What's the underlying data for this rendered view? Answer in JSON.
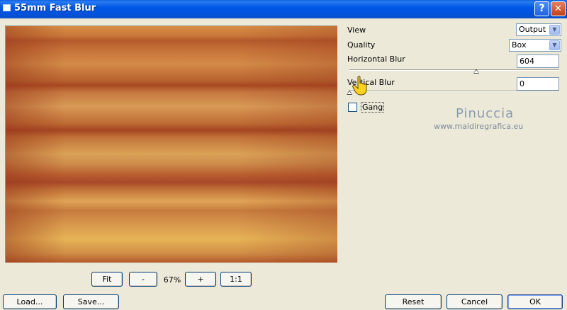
{
  "window": {
    "title": "55mm Fast Blur",
    "help_glyph": "?",
    "close_glyph": "✕"
  },
  "preview": {
    "zoom_fit": "Fit",
    "zoom_out": "-",
    "zoom_level": "67%",
    "zoom_in": "+",
    "zoom_actual": "1:1"
  },
  "controls": {
    "view": {
      "label": "View",
      "value": "Output"
    },
    "quality": {
      "label": "Quality",
      "value": "Box"
    },
    "horizontal_blur": {
      "label": "Horizontal Blur",
      "value": "604",
      "level": 0.604
    },
    "vertical_blur": {
      "label": "Vertical Blur",
      "value": "0",
      "level": 0
    },
    "gang": {
      "label": "Gang",
      "checked": false
    }
  },
  "watermark": {
    "name": "Pinuccia",
    "url": "www.maidiregrafica.eu"
  },
  "buttons": {
    "load": "Load...",
    "save": "Save...",
    "reset": "Reset",
    "cancel": "Cancel",
    "ok": "OK"
  },
  "colors": {
    "titlebar": "#0054e3",
    "dialog_bg": "#ece9d8"
  }
}
